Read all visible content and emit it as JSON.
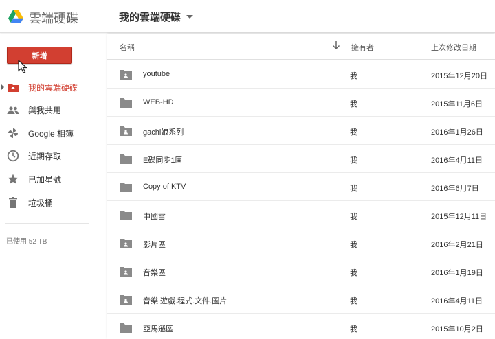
{
  "header": {
    "app_title": "雲端硬碟",
    "breadcrumb": "我的雲端硬碟"
  },
  "sidebar": {
    "new_button": "新增",
    "items": [
      {
        "label": "我的雲端硬碟",
        "icon": "drive-folder-icon",
        "active": true
      },
      {
        "label": "與我共用",
        "icon": "people-icon"
      },
      {
        "label": "Google 相簿",
        "icon": "pinwheel-icon"
      },
      {
        "label": "近期存取",
        "icon": "clock-icon"
      },
      {
        "label": "已加星號",
        "icon": "star-icon"
      },
      {
        "label": "垃圾桶",
        "icon": "trash-icon"
      }
    ],
    "storage": "已使用 52 TB"
  },
  "list": {
    "columns": {
      "name": "名稱",
      "owner": "擁有者",
      "modified": "上次修改日期"
    },
    "rows": [
      {
        "name": "youtube",
        "owner": "我",
        "date": "2015年12月20日",
        "icon": "shared-folder-icon"
      },
      {
        "name": "WEB-HD",
        "owner": "我",
        "date": "2015年11月6日",
        "icon": "folder-icon"
      },
      {
        "name": "gachi娘系列",
        "owner": "我",
        "date": "2016年1月26日",
        "icon": "shared-folder-icon"
      },
      {
        "name": "E碟同步1區",
        "owner": "我",
        "date": "2016年4月11日",
        "icon": "folder-icon"
      },
      {
        "name": "Copy of KTV",
        "owner": "我",
        "date": "2016年6月7日",
        "icon": "folder-icon"
      },
      {
        "name": "中國雪",
        "owner": "我",
        "date": "2015年12月11日",
        "icon": "folder-icon"
      },
      {
        "name": "影片區",
        "owner": "我",
        "date": "2016年2月21日",
        "icon": "shared-folder-icon"
      },
      {
        "name": "音樂區",
        "owner": "我",
        "date": "2016年1月19日",
        "icon": "shared-folder-icon"
      },
      {
        "name": "音樂.遊戲.程式.文件.圖片",
        "owner": "我",
        "date": "2016年4月11日",
        "icon": "shared-folder-icon"
      },
      {
        "name": "亞馬遜區",
        "owner": "我",
        "date": "2015年10月2日",
        "icon": "folder-icon"
      }
    ]
  },
  "colors": {
    "accent": "#d23f31",
    "icon_gray": "#8a8a8a"
  }
}
